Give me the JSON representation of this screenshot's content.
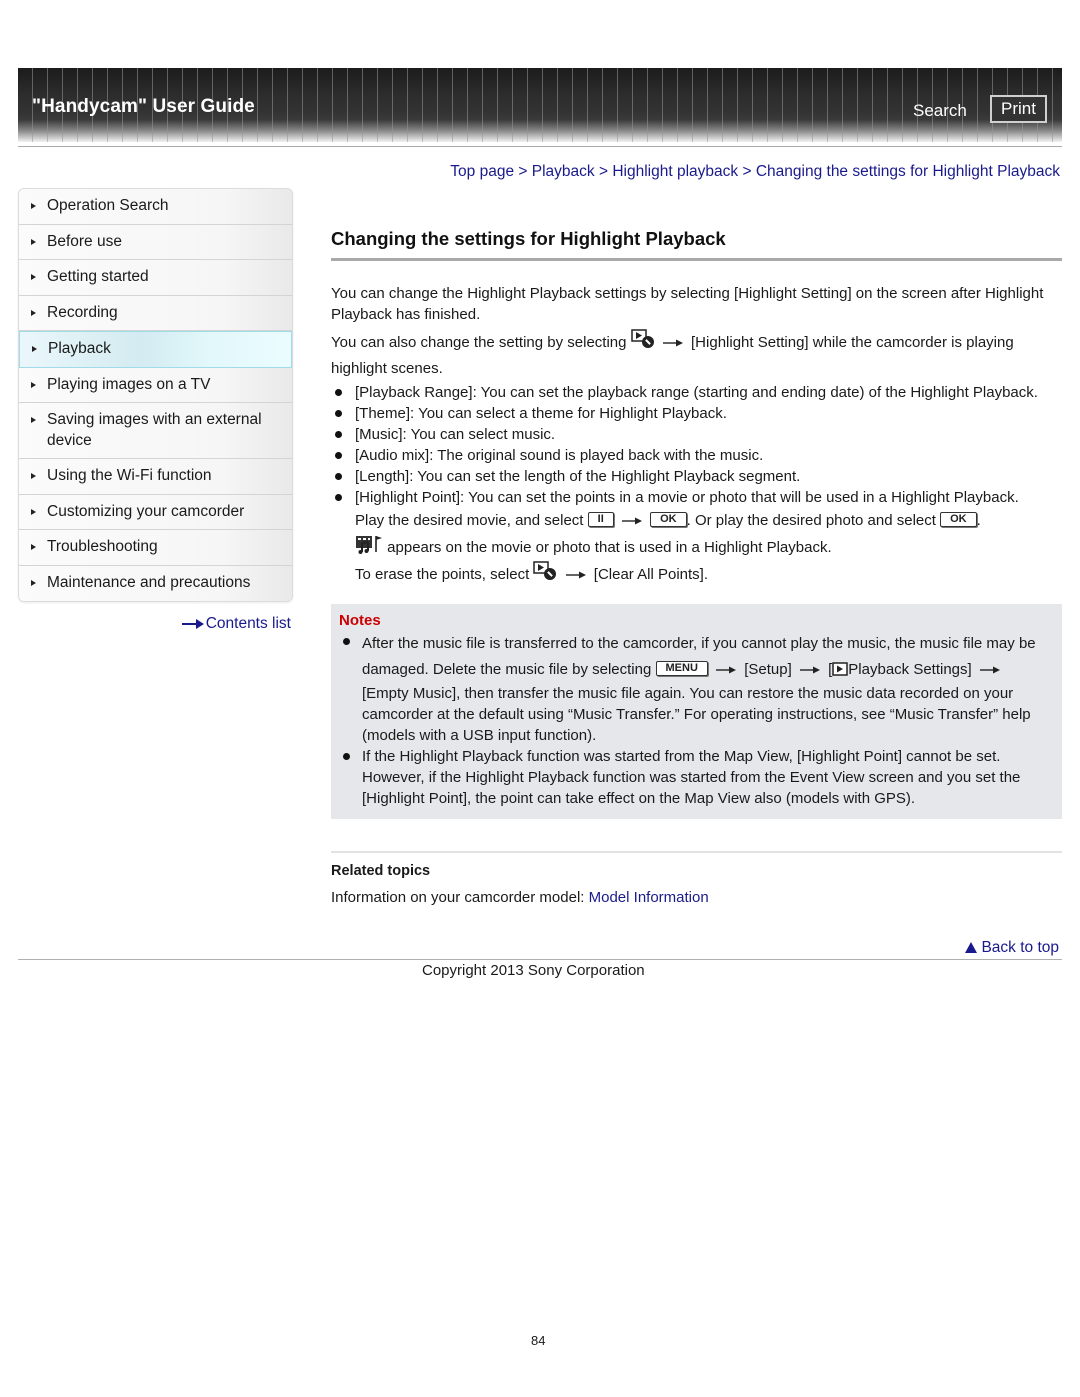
{
  "header": {
    "title": "\"Handycam\" User Guide",
    "search_label": "Search",
    "print_label": "Print"
  },
  "breadcrumb": [
    {
      "label": "Top page"
    },
    {
      "label": "Playback"
    },
    {
      "label": "Highlight playback"
    },
    {
      "label": "Changing the settings for Highlight Playback"
    }
  ],
  "breadcrumb_separator": ">",
  "sidebar": {
    "items": [
      {
        "label": "Operation Search",
        "active": false
      },
      {
        "label": "Before use",
        "active": false
      },
      {
        "label": "Getting started",
        "active": false
      },
      {
        "label": "Recording",
        "active": false
      },
      {
        "label": "Playback",
        "active": true
      },
      {
        "label": "Playing images on a TV",
        "active": false
      },
      {
        "label": "Saving images with an external device",
        "active": false
      },
      {
        "label": "Using the Wi-Fi function",
        "active": false
      },
      {
        "label": "Customizing your camcorder",
        "active": false
      },
      {
        "label": "Troubleshooting",
        "active": false
      },
      {
        "label": "Maintenance and precautions",
        "active": false
      }
    ],
    "contents_link": "Contents list"
  },
  "main": {
    "title": "Changing the settings for Highlight Playback",
    "intro1": "You can change the Highlight Playback settings by selecting [Highlight Setting] on the screen after Highlight Playback has finished.",
    "intro2_a": "You can also change the setting by selecting",
    "intro2_b": "[Highlight Setting] while the camcorder is playing highlight scenes.",
    "bullets": [
      "[Playback Range]: You can set the playback range (starting and ending date) of the Highlight Playback.",
      "[Theme]: You can select a theme for Highlight Playback.",
      "[Music]: You can select music.",
      "[Audio mix]: The original sound is played back with the music.",
      "[Length]: You can set the length of the Highlight Playback segment.",
      "[Highlight Point]: You can set the points in a movie or photo that will be used in a Highlight Playback."
    ],
    "hp_line1_a": "Play the desired movie, and select",
    "hp_line1_b": ". Or play the desired photo and select",
    "hp_line1_c": ".",
    "hp_line2": "appears on the movie or photo that is used in a Highlight Playback.",
    "hp_line3_a": "To erase the points, select",
    "hp_line3_b": "[Clear All Points].",
    "keys": {
      "pause": "II",
      "ok": "OK",
      "menu": "MENU"
    },
    "icons": [
      "playback-settings-icon",
      "highlight-point-icon",
      "pause-button-icon",
      "ok-button-icon",
      "menu-button-icon",
      "right-arrow-icon",
      "playback-mode-icon"
    ]
  },
  "notes": {
    "title": "Notes",
    "note1_a": "After the music file is transferred to the camcorder, if you cannot play the music, the music file may be damaged. Delete the music file by selecting",
    "note1_setup": "[Setup]",
    "note1_bracket": "[",
    "note1_pbs": "Playback Settings]",
    "note1_b": "[Empty Music], then transfer the music file again. You can restore the music data recorded on your camcorder at the default using “Music Transfer.” For operating instructions, see “Music Transfer” help (models with a USB input function).",
    "note2": "If the Highlight Playback function was started from the Map View, [Highlight Point] cannot be set. However, if the Highlight Playback function was started from the Event View screen and you set the [Highlight Point], the point can take effect on the Map View also (models with GPS)."
  },
  "related": {
    "title": "Related topics",
    "prefix": "Information on your camcorder model:",
    "link": "Model Information"
  },
  "footer": {
    "back_to_top": "Back to top",
    "copyright": "Copyright 2013 Sony Corporation",
    "page_number": "84"
  },
  "colors": {
    "link": "#1a1a8c",
    "notes_title": "#cc0000",
    "notes_bg": "#e6e7ea",
    "active_nav": "#d3ebf1"
  }
}
